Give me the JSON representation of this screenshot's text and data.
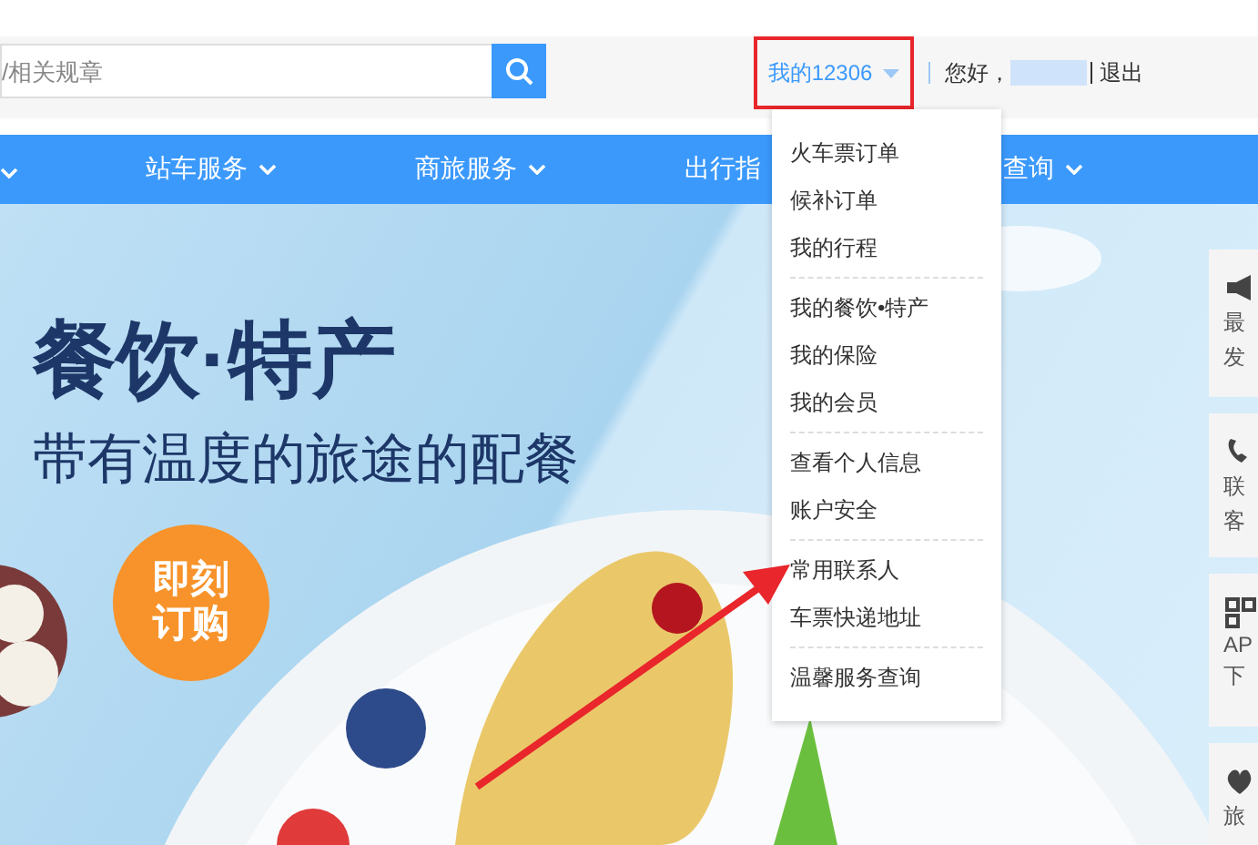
{
  "search": {
    "placeholder": "/相关规章"
  },
  "account": {
    "menu_label": "我的12306",
    "greeting": "您好，",
    "logout": "退出",
    "expanded": true,
    "menu_groups": [
      {
        "items": [
          "火车票订单",
          "候补订单",
          "我的行程"
        ]
      },
      {
        "items": [
          "我的餐饮•特产",
          "我的保险",
          "我的会员"
        ]
      },
      {
        "items": [
          "查看个人信息",
          "账户安全"
        ]
      },
      {
        "items": [
          "常用联系人",
          "车票快递地址"
        ]
      },
      {
        "items": [
          "温馨服务查询"
        ]
      }
    ]
  },
  "nav": [
    {
      "label": "站车服务"
    },
    {
      "label": "商旅服务"
    },
    {
      "label": "出行指"
    },
    {
      "label": "查询"
    }
  ],
  "banner": {
    "title": "餐饮·特产",
    "subtitle": "带有温度的旅途的配餐",
    "cta_lines": [
      "即刻",
      "订购"
    ]
  },
  "side_cards": [
    {
      "kind": "megaphone",
      "lines": [
        "最",
        "发"
      ]
    },
    {
      "kind": "phone",
      "lines": [
        "联",
        "客"
      ]
    },
    {
      "kind": "qr",
      "lines": [
        "AP",
        "下"
      ]
    },
    {
      "kind": "heart",
      "lines": [
        "旅"
      ]
    }
  ]
}
